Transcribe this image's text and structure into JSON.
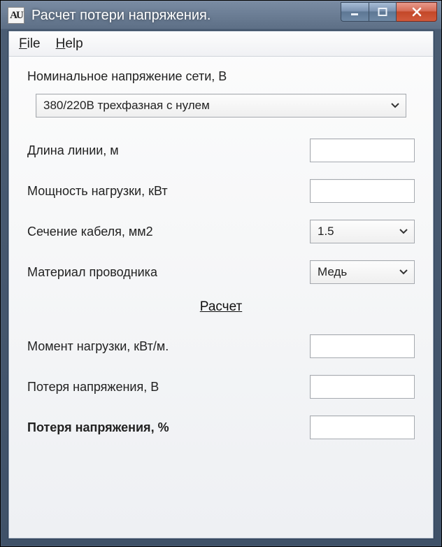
{
  "window": {
    "title": "Расчет потери напряжения.",
    "icon_text": "AU"
  },
  "menu": {
    "file": "File",
    "help": "Help"
  },
  "labels": {
    "nominal_voltage": "Номинальное напряжение сети, В",
    "line_length": "Длина линии, м",
    "load_power": "Мощность нагрузки, кВт",
    "cable_section": "Сечение кабеля, мм2",
    "conductor_material": "Материал проводника",
    "calculate": "Расчет",
    "load_moment": "Момент нагрузки, кВт/м.",
    "voltage_loss_v": "Потеря напряжения, В",
    "voltage_loss_pct": "Потеря напряжения, %"
  },
  "values": {
    "nominal_voltage": "380/220В  трехфазная с нулем",
    "line_length": "",
    "load_power": "",
    "cable_section": "1.5",
    "conductor_material": "Медь",
    "load_moment": "",
    "voltage_loss_v": "",
    "voltage_loss_pct": ""
  }
}
